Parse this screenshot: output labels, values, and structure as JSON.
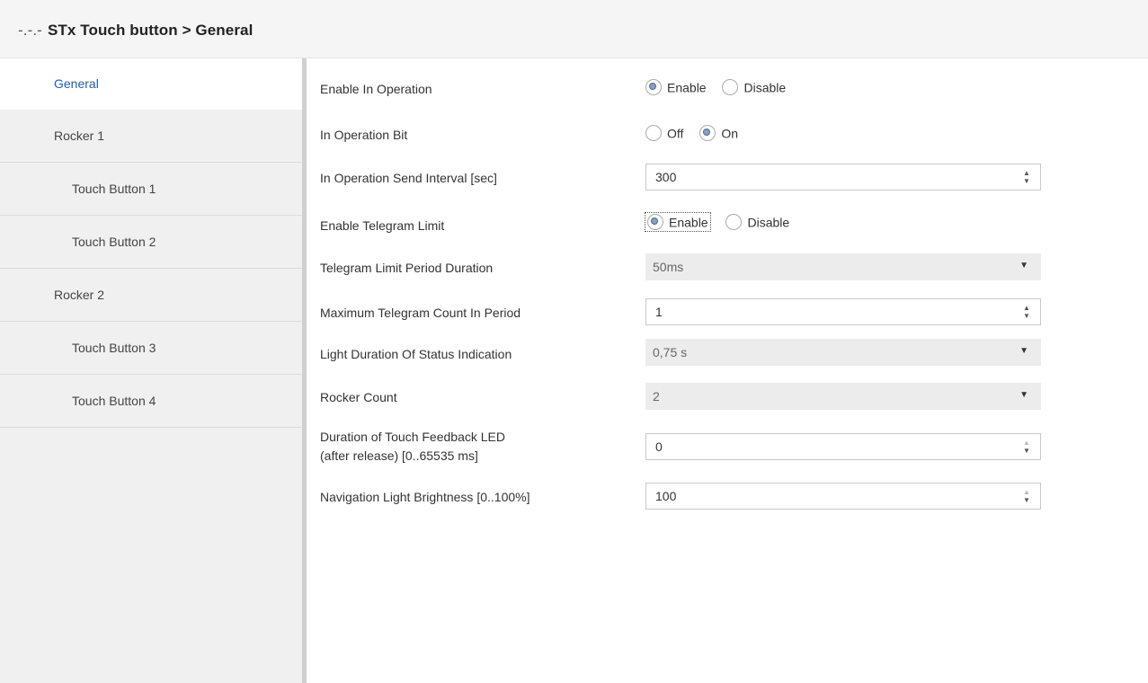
{
  "header": {
    "crumb": "-.-.-",
    "title": "STx Touch button > General"
  },
  "sidebar": {
    "items": [
      {
        "label": "General"
      },
      {
        "label": "Rocker 1"
      },
      {
        "label": "Touch Button 1"
      },
      {
        "label": "Touch Button 2"
      },
      {
        "label": "Rocker 2"
      },
      {
        "label": "Touch Button 3"
      },
      {
        "label": "Touch Button 4"
      }
    ]
  },
  "params": {
    "enable_in_operation": {
      "label": "Enable In Operation",
      "opt1": "Enable",
      "opt2": "Disable",
      "selected": "Enable"
    },
    "in_operation_bit": {
      "label": "In Operation Bit",
      "opt1": "Off",
      "opt2": "On",
      "selected": "On"
    },
    "send_interval": {
      "label": "In Operation Send Interval [sec]",
      "value": "300"
    },
    "enable_telegram_limit": {
      "label": "Enable Telegram Limit",
      "opt1": "Enable",
      "opt2": "Disable",
      "selected": "Enable"
    },
    "telegram_limit_period": {
      "label": "Telegram Limit Period Duration",
      "value": "50ms"
    },
    "max_telegram_count": {
      "label": "Maximum Telegram Count In Period",
      "value": "1"
    },
    "light_duration": {
      "label": "Light Duration Of Status Indication",
      "value": "0,75 s"
    },
    "rocker_count": {
      "label": "Rocker Count",
      "value": "2"
    },
    "touch_feedback": {
      "label_line1": "Duration of Touch Feedback LED",
      "label_line2": "(after release) [0..65535 ms]",
      "value": "0"
    },
    "nav_brightness": {
      "label": "Navigation Light Brightness [0..100%]",
      "value": "100"
    }
  },
  "icons": {
    "spin": "up-down-arrows-icon",
    "dropdown": "chevron-down-icon"
  }
}
